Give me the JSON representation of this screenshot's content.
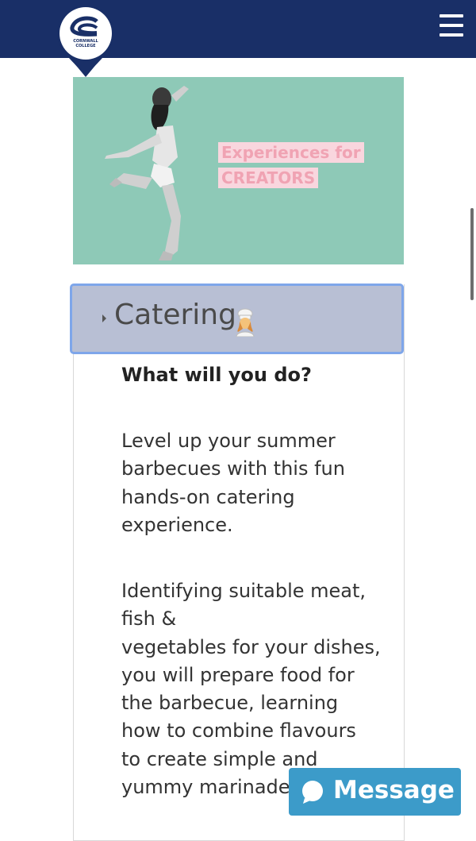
{
  "header": {
    "logo_text_line1": "CORNWALL",
    "logo_text_line2": "COLLEGE",
    "menu_icon": "hamburger-menu-icon",
    "background": "#192f67"
  },
  "banner": {
    "line1": "Experiences for",
    "line2": "CREATORS",
    "background": "#8ec9b7"
  },
  "accordion": {
    "title": "Catering",
    "icon": "chef-emoji-icon",
    "heading": "What will you do?",
    "paragraph1": "Level up your summer\nbarbecues with this fun\nhands-on catering\nexperience.",
    "paragraph2": "Identifying suitable meat,\nfish &\nvegetables for your dishes,\nyou will prepare food for\nthe barbecue, learning\nhow to combine flavours\nto create simple and\nyummy marinades"
  },
  "chat": {
    "label": "Message",
    "color": "#3c9bc9"
  }
}
